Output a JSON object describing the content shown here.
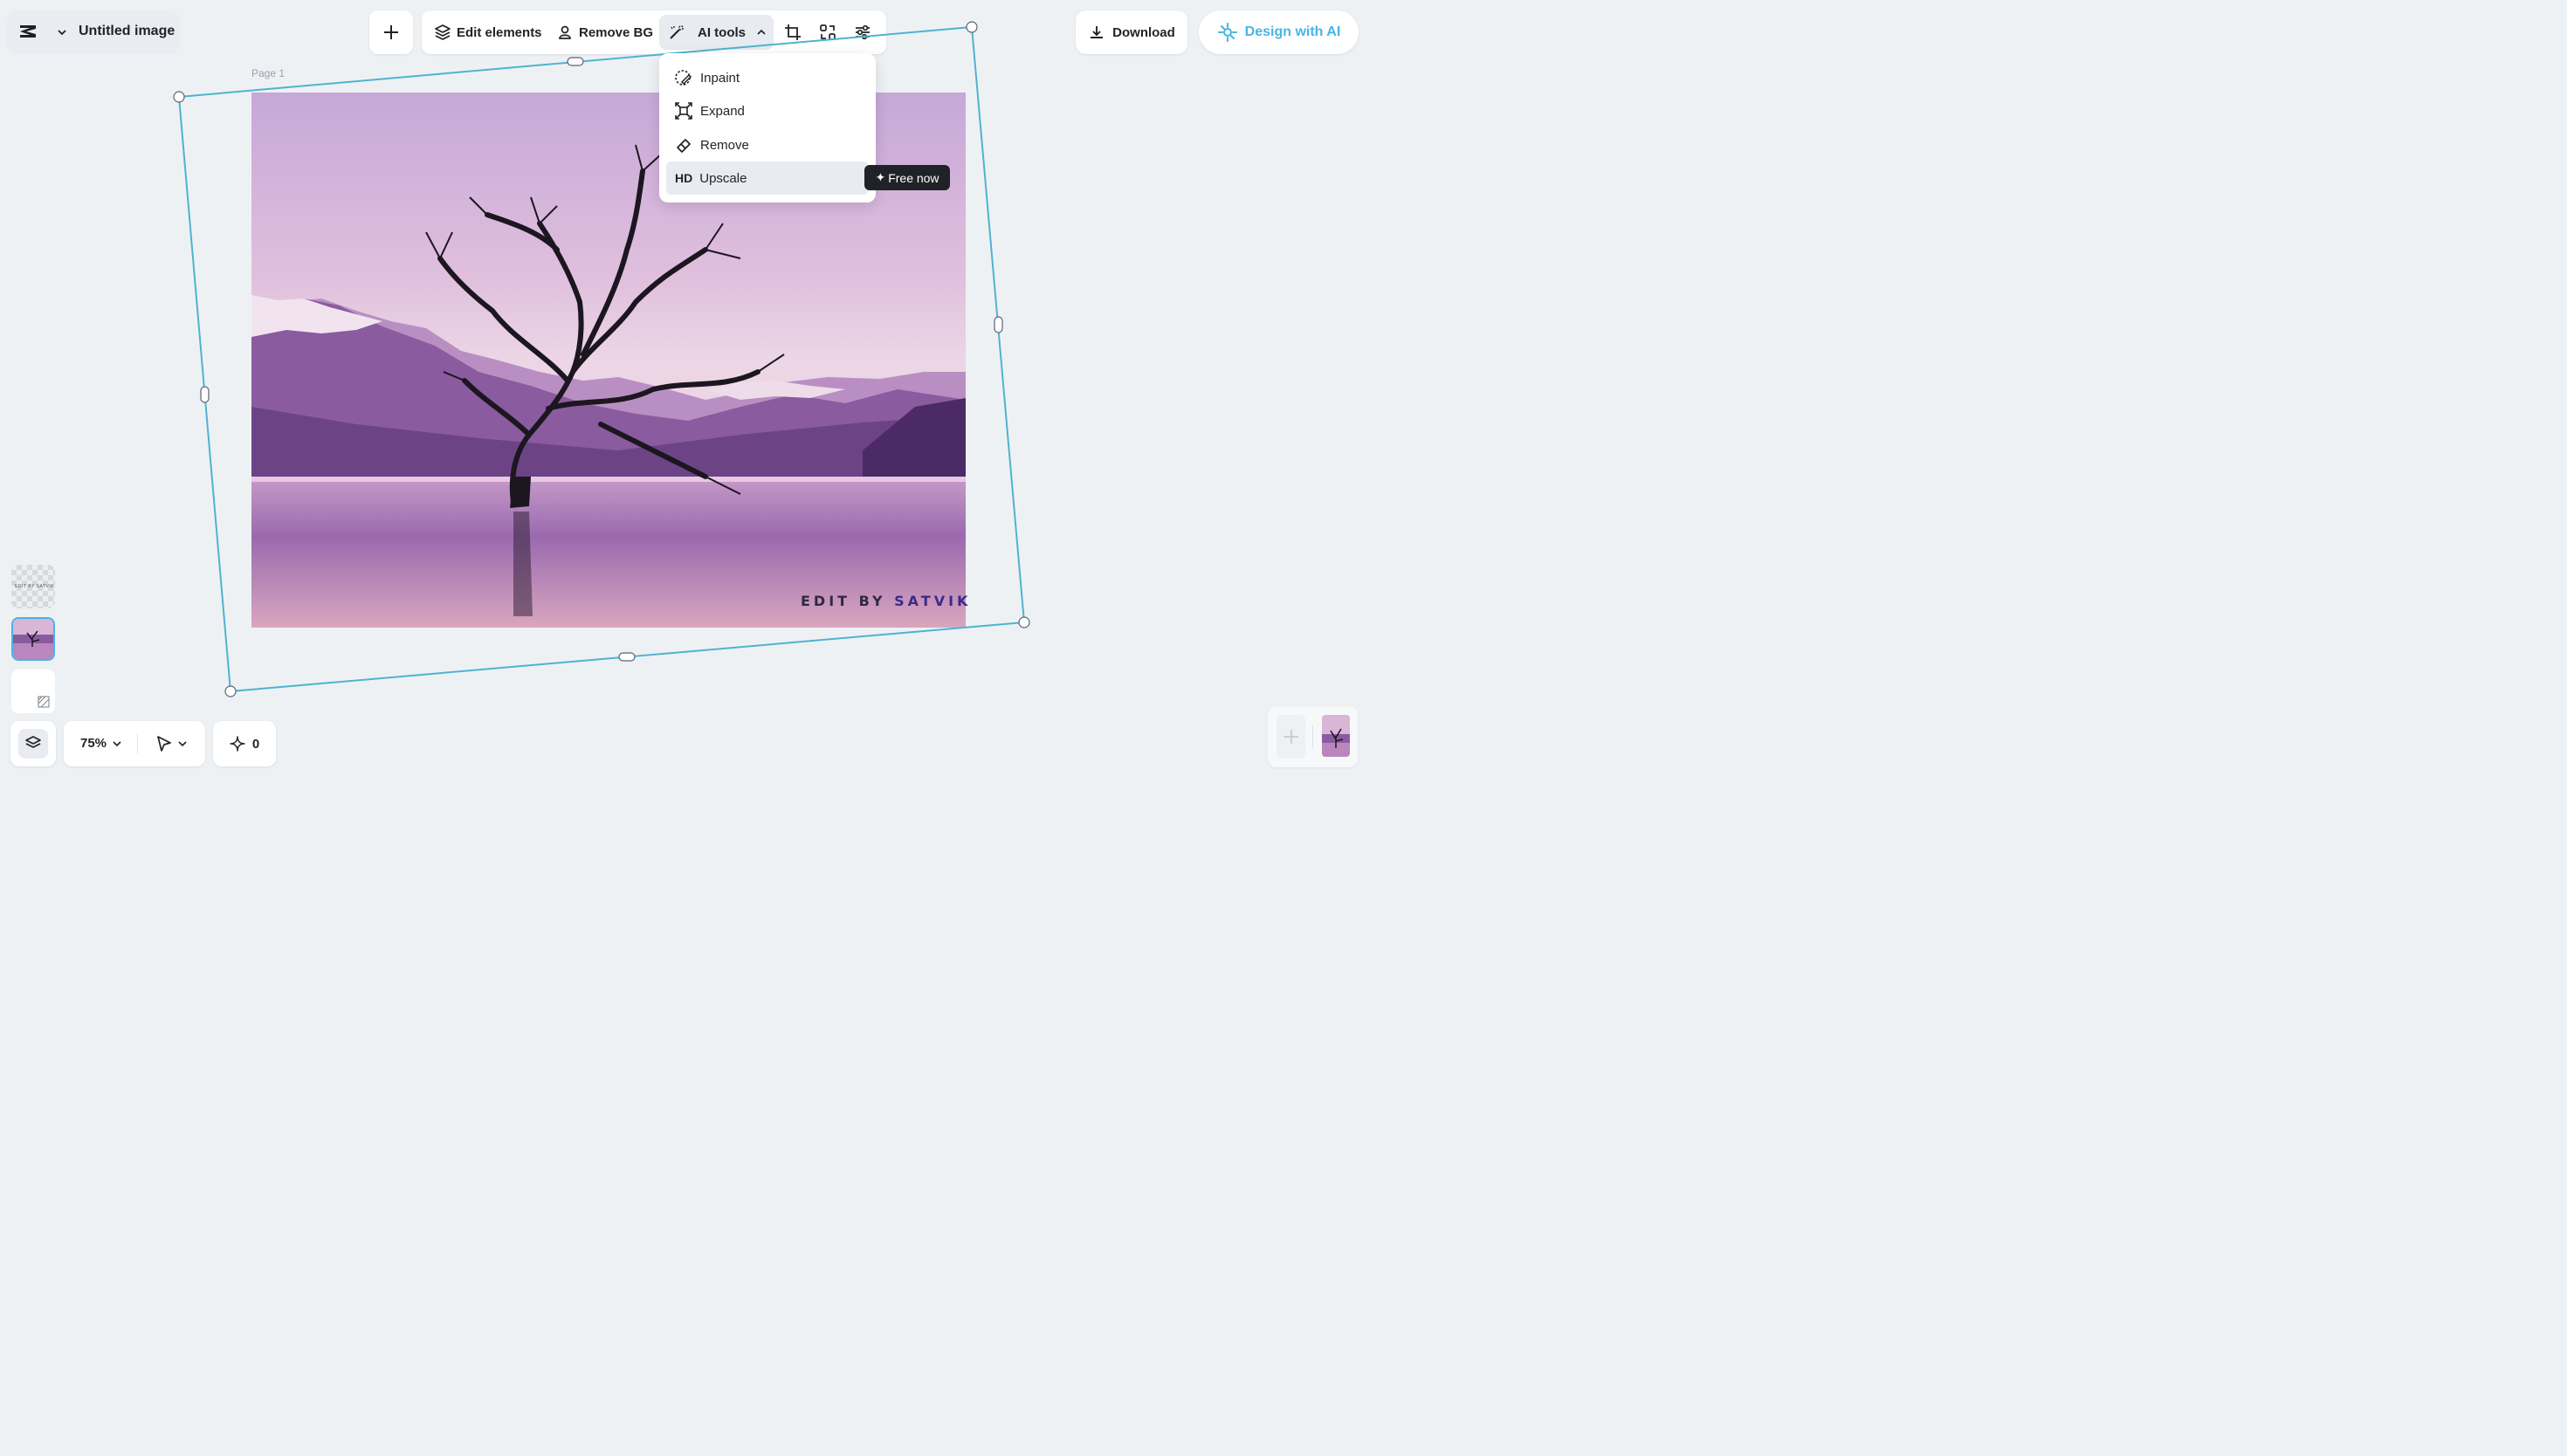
{
  "app": {
    "title": "Untitled image",
    "brand": "capcut-logo"
  },
  "toolbar": {
    "add_label": "+",
    "edit_elements": "Edit elements",
    "remove_bg": "Remove BG",
    "ai_tools": "AI tools",
    "icons": [
      "crop-icon",
      "resize-icon",
      "adjust-icon"
    ]
  },
  "actions": {
    "download": "Download",
    "design_with_ai": "Design with AI"
  },
  "canvas": {
    "page_label": "Page 1",
    "watermark_prefix": "EDIT BY",
    "watermark_name": "SATVIK"
  },
  "ai_menu": {
    "items": [
      {
        "label": "Inpaint",
        "icon": "inpaint-icon"
      },
      {
        "label": "Expand",
        "icon": "expand-icon"
      },
      {
        "label": "Remove",
        "icon": "eraser-icon"
      },
      {
        "label": "Upscale",
        "icon": "hd-icon",
        "badge_text": "HD"
      }
    ],
    "promo_badge": "Free now"
  },
  "bottom_bar": {
    "zoom": "75%",
    "credits": "0"
  },
  "colors": {
    "accent": "#47b5e6",
    "selection": "#4fb3d0",
    "background": "#eef1f4"
  }
}
